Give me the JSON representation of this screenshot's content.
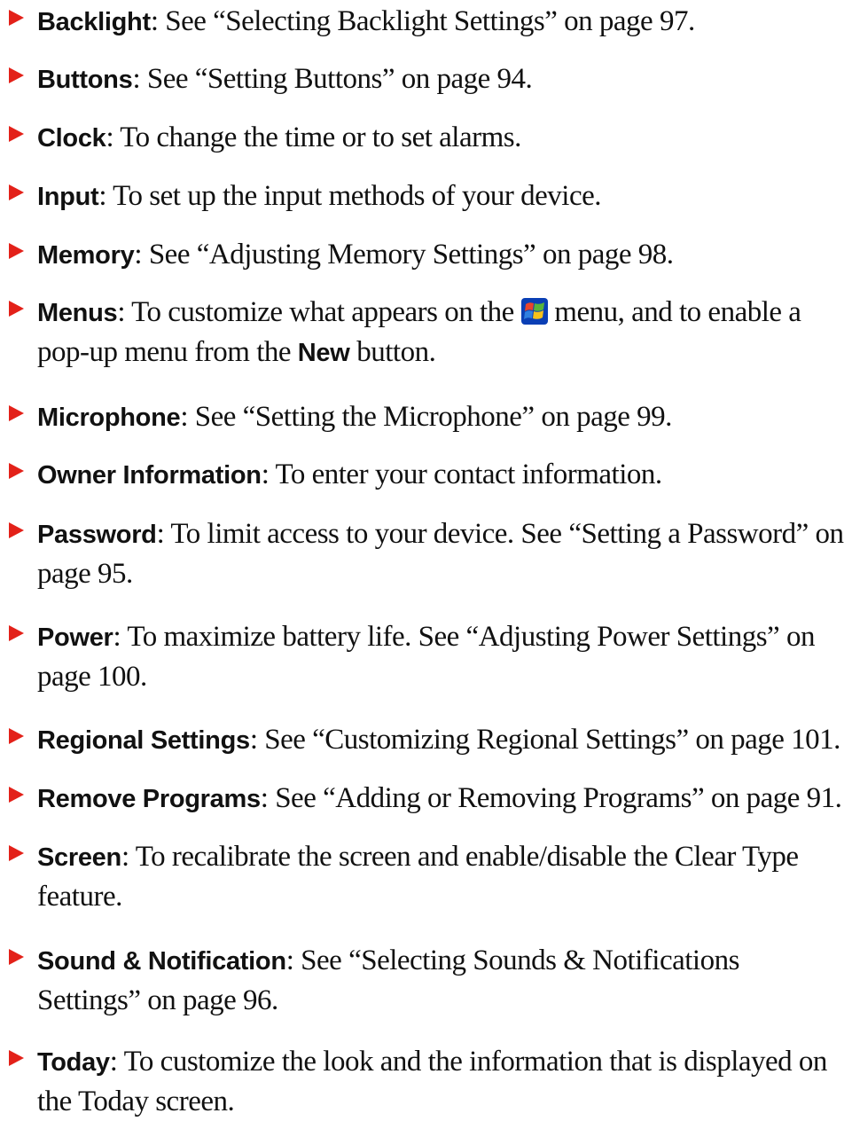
{
  "items": [
    {
      "term": "Backlight",
      "desc": ": See “Selecting Backlight Settings” on page 97."
    },
    {
      "term": "Buttons",
      "desc": ": See “Setting Buttons” on page 94."
    },
    {
      "term": "Clock",
      "desc": ": To change the time or to set alarms."
    },
    {
      "term": "Input",
      "desc": ": To set up the input methods of your device."
    },
    {
      "term": "Memory",
      "desc": ": See “Adjusting Memory Settings” on page 98."
    },
    {
      "term": "Menus",
      "desc_before": ": To customize what appears on the ",
      "icon": "windows-start-icon",
      "desc_middle": " menu, and to enable a pop-up menu from the ",
      "bold_word": "New",
      "desc_after": " button."
    },
    {
      "term": "Microphone",
      "desc": ": See “Setting the Microphone” on page 99."
    },
    {
      "term": "Owner Information",
      "desc": ": To enter your contact information."
    },
    {
      "term": "Password",
      "desc": ": To limit access to your device. See “Setting a Password” on page 95."
    },
    {
      "term": "Power",
      "desc": ": To maximize battery life. See “Adjusting Power Settings” on page 100."
    },
    {
      "term": "Regional Settings",
      "desc": ": See “Customizing Regional Settings” on page 101."
    },
    {
      "term": "Remove Programs",
      "desc": ": See “Adding or Removing Programs” on page 91."
    },
    {
      "term": "Screen",
      "desc": ": To recalibrate the screen and enable/disable the Clear Type feature."
    },
    {
      "term": "Sound & Notification",
      "desc": ": See “Selecting Sounds & Notifications Settings” on page 96."
    },
    {
      "term": "Today",
      "desc": ": To customize the look and the information that is displayed on the Today screen."
    }
  ],
  "colors": {
    "bullet": "#e32119",
    "text": "#111111"
  }
}
